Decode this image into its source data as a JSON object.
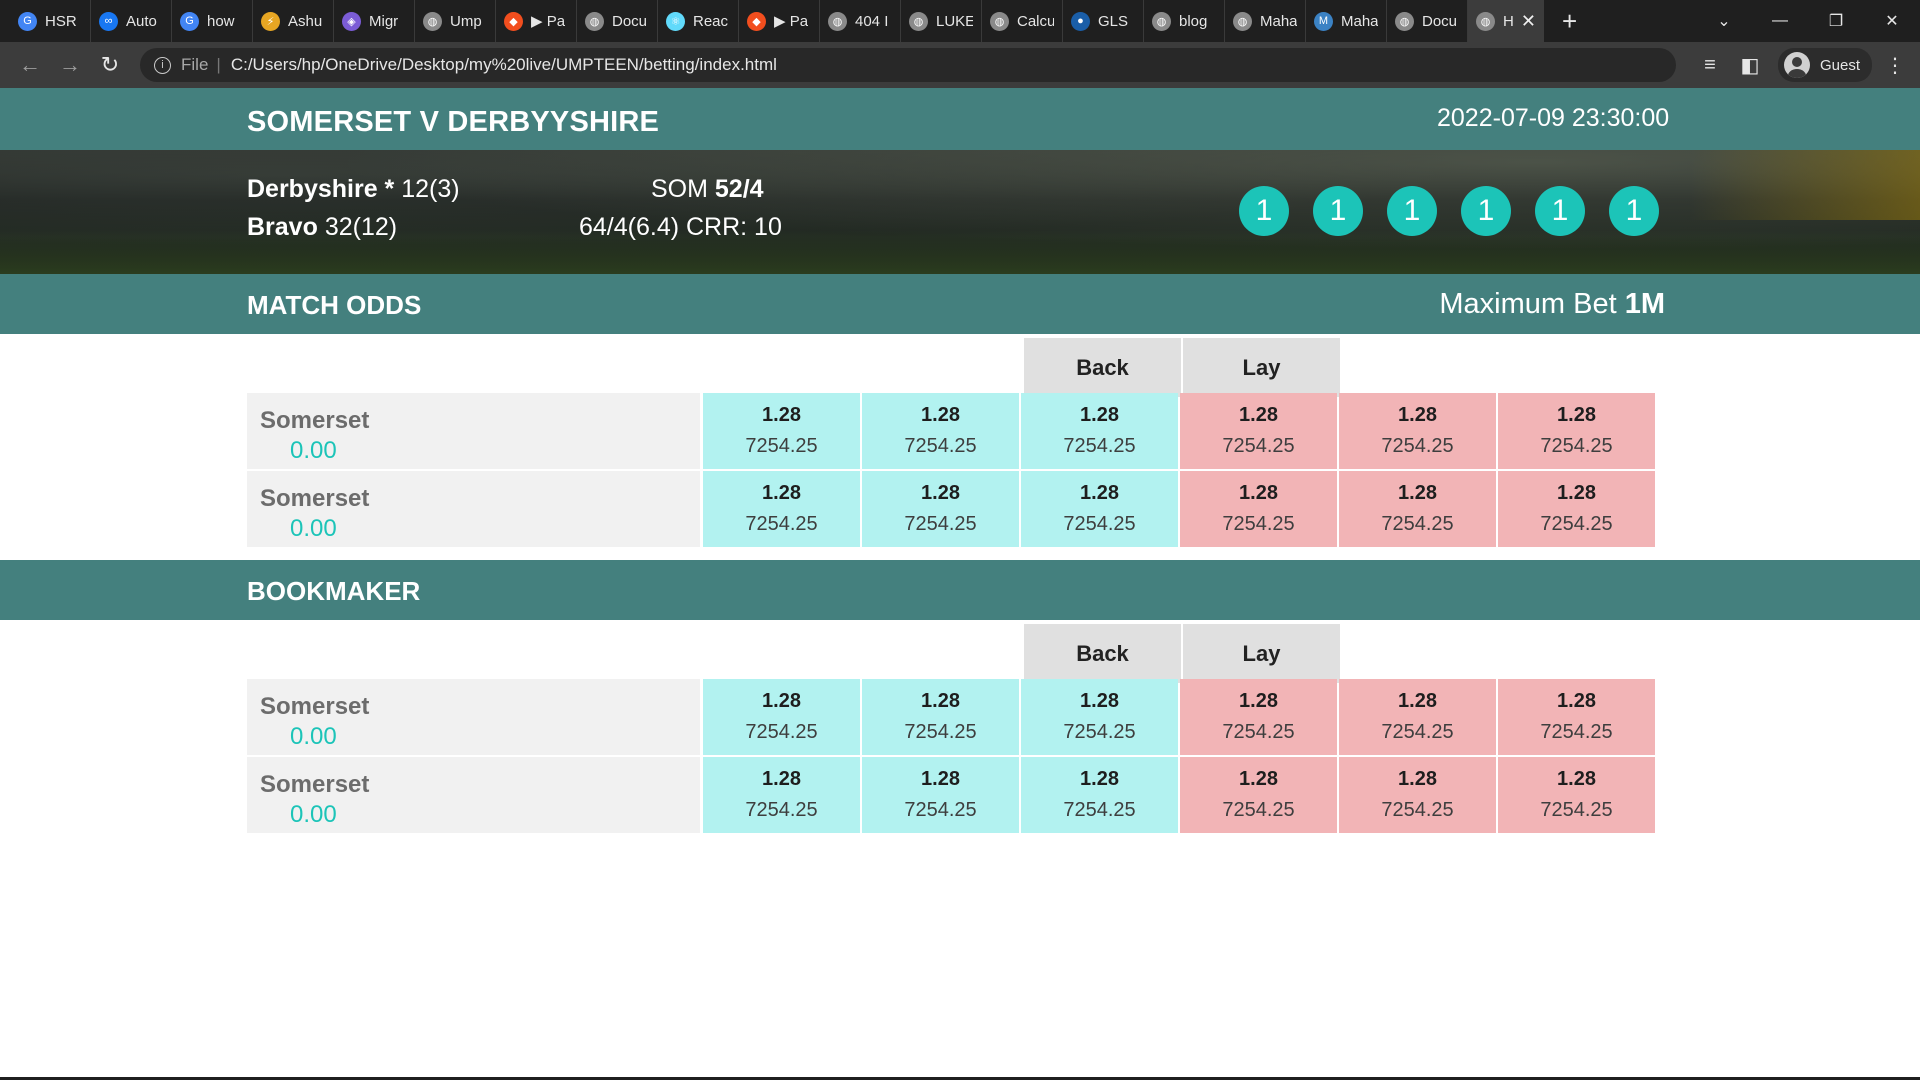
{
  "browser": {
    "tabs": [
      {
        "label": "HSR",
        "icon": "google-icon",
        "color": "#4285f4",
        "glyph": "G"
      },
      {
        "label": "Auto",
        "icon": "meta-icon",
        "color": "#1877f2",
        "glyph": "∞"
      },
      {
        "label": "how",
        "icon": "google-icon",
        "color": "#4285f4",
        "glyph": "G"
      },
      {
        "label": "Ashu",
        "icon": "lightning-icon",
        "color": "#e7a623",
        "glyph": "⚡"
      },
      {
        "label": "Migr",
        "icon": "app-icon",
        "color": "#7b5cd6",
        "glyph": "◈"
      },
      {
        "label": "Ump",
        "icon": "globe-icon",
        "color": "#8a8a8a",
        "glyph": "◍"
      },
      {
        "label": "▶ Pa",
        "icon": "figma-icon",
        "color": "#f24e1e",
        "glyph": "◆"
      },
      {
        "label": "Docu",
        "icon": "globe-icon",
        "color": "#8a8a8a",
        "glyph": "◍"
      },
      {
        "label": "Reac",
        "icon": "react-icon",
        "color": "#61dafb",
        "glyph": "⚛"
      },
      {
        "label": "▶ Pa",
        "icon": "figma-icon",
        "color": "#f24e1e",
        "glyph": "◆"
      },
      {
        "label": "404 I",
        "icon": "globe-icon",
        "color": "#8a8a8a",
        "glyph": "◍"
      },
      {
        "label": "LUKE",
        "icon": "globe-icon",
        "color": "#8a8a8a",
        "glyph": "◍"
      },
      {
        "label": "Calcu",
        "icon": "globe-icon",
        "color": "#8a8a8a",
        "glyph": "◍"
      },
      {
        "label": "GLS",
        "icon": "circle-icon",
        "color": "#1a5ea8",
        "glyph": "●"
      },
      {
        "label": "blog",
        "icon": "globe-icon",
        "color": "#8a8a8a",
        "glyph": "◍"
      },
      {
        "label": "Maha",
        "icon": "globe-icon",
        "color": "#8a8a8a",
        "glyph": "◍"
      },
      {
        "label": "Maha",
        "icon": "m-icon",
        "color": "#3b82c4",
        "glyph": "M"
      },
      {
        "label": "Docu",
        "icon": "globe-icon",
        "color": "#8a8a8a",
        "glyph": "◍"
      }
    ],
    "active_tab": {
      "label": "H",
      "icon": "globe-icon"
    },
    "address": {
      "scheme_label": "File",
      "url": "C:/Users/hp/OneDrive/Desktop/my%20live/UMPTEEN/betting/index.html"
    },
    "profile_label": "Guest"
  },
  "match": {
    "title": "SOMERSET V DERBYYSHIRE",
    "datetime": "2022-07-09 23:30:00"
  },
  "scoreboard": {
    "batsman1_name": "Derbyshire *",
    "batsman1_score": "12(3)",
    "batsman2_name": "Bravo",
    "batsman2_score": "32(12)",
    "team_label": "SOM",
    "team_score": "52/4",
    "summary": "64/4(6.4) CRR: 10",
    "recent_balls": [
      "1",
      "1",
      "1",
      "1",
      "1",
      "1"
    ]
  },
  "match_odds": {
    "title": "MATCH ODDS",
    "max_bet_label": "Maximum Bet",
    "max_bet_value": "1M",
    "back_label": "Back",
    "lay_label": "Lay",
    "runners": [
      {
        "name": "Somerset",
        "pl": "0.00",
        "back": [
          {
            "price": "1.28",
            "size": "7254.25"
          },
          {
            "price": "1.28",
            "size": "7254.25"
          },
          {
            "price": "1.28",
            "size": "7254.25"
          }
        ],
        "lay": [
          {
            "price": "1.28",
            "size": "7254.25"
          },
          {
            "price": "1.28",
            "size": "7254.25"
          },
          {
            "price": "1.28",
            "size": "7254.25"
          }
        ]
      },
      {
        "name": "Somerset",
        "pl": "0.00",
        "back": [
          {
            "price": "1.28",
            "size": "7254.25"
          },
          {
            "price": "1.28",
            "size": "7254.25"
          },
          {
            "price": "1.28",
            "size": "7254.25"
          }
        ],
        "lay": [
          {
            "price": "1.28",
            "size": "7254.25"
          },
          {
            "price": "1.28",
            "size": "7254.25"
          },
          {
            "price": "1.28",
            "size": "7254.25"
          }
        ]
      }
    ]
  },
  "bookmaker": {
    "title": "BOOKMAKER",
    "back_label": "Back",
    "lay_label": "Lay",
    "runners": [
      {
        "name": "Somerset",
        "pl": "0.00",
        "back": [
          {
            "price": "1.28",
            "size": "7254.25"
          },
          {
            "price": "1.28",
            "size": "7254.25"
          },
          {
            "price": "1.28",
            "size": "7254.25"
          }
        ],
        "lay": [
          {
            "price": "1.28",
            "size": "7254.25"
          },
          {
            "price": "1.28",
            "size": "7254.25"
          },
          {
            "price": "1.28",
            "size": "7254.25"
          }
        ]
      },
      {
        "name": "Somerset",
        "pl": "0.00",
        "back": [
          {
            "price": "1.28",
            "size": "7254.25"
          },
          {
            "price": "1.28",
            "size": "7254.25"
          },
          {
            "price": "1.28",
            "size": "7254.25"
          }
        ],
        "lay": [
          {
            "price": "1.28",
            "size": "7254.25"
          },
          {
            "price": "1.28",
            "size": "7254.25"
          },
          {
            "price": "1.28",
            "size": "7254.25"
          }
        ]
      }
    ]
  },
  "colors": {
    "header_teal": "#44807e",
    "back_blue": "#b2f2f0",
    "lay_pink": "#f2b4b6",
    "ball_teal": "#1cc4b8",
    "pl_teal": "#1cc4b8"
  }
}
